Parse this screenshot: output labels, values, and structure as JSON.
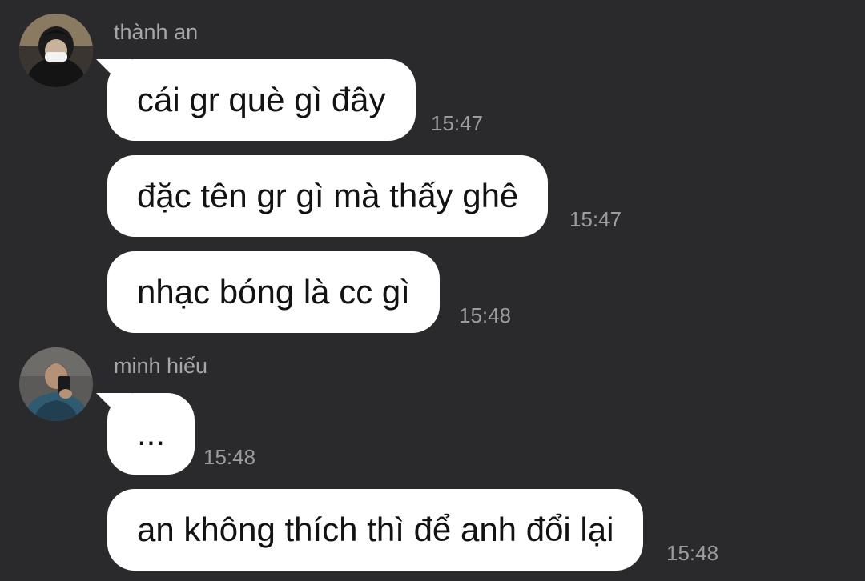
{
  "groups": [
    {
      "sender": "thành an",
      "messages": [
        {
          "text": "cái gr què gì đây",
          "time": "15:47"
        },
        {
          "text": "đặc tên gr gì mà thấy ghê",
          "time": "15:47"
        },
        {
          "text": "nhạc bóng là cc gì",
          "time": "15:48"
        }
      ]
    },
    {
      "sender": "minh hiếu",
      "messages": [
        {
          "text": "...",
          "time": "15:48"
        },
        {
          "text": "an không thích thì để anh đổi lại",
          "time": "15:48"
        }
      ]
    }
  ],
  "colors": {
    "background": "#2a2a2c",
    "bubble": "#ffffff",
    "message_text": "#121212",
    "secondary_text": "#a6a6ab"
  }
}
